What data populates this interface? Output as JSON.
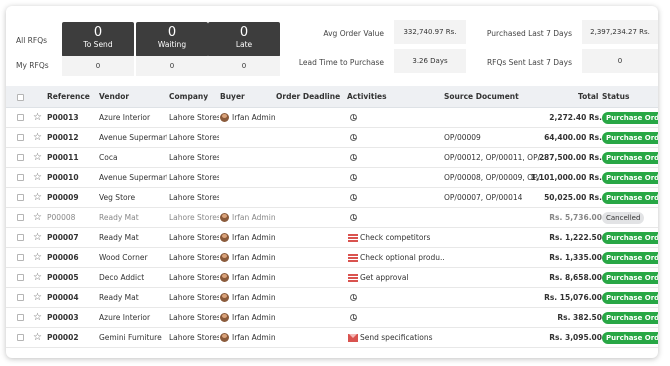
{
  "dashboard": {
    "all_rfqs_label": "All RFQs",
    "my_rfqs_label": "My RFQs",
    "boxes": [
      {
        "count": "0",
        "label": "To Send",
        "my": "0"
      },
      {
        "count": "0",
        "label": "Waiting",
        "my": "0"
      },
      {
        "count": "0",
        "label": "Late",
        "my": "0"
      }
    ],
    "stats": {
      "avg_order_value_label": "Avg Order Value",
      "avg_order_value": "332,740.97 Rs.",
      "purchased_7d_label": "Purchased Last 7 Days",
      "purchased_7d": "2,397,234.27 Rs.",
      "lead_time_label": "Lead Time to Purchase",
      "lead_time": "3.26 Days",
      "rfqs_sent_label": "RFQs Sent Last 7 Days",
      "rfqs_sent": "0"
    }
  },
  "table": {
    "headers": {
      "reference": "Reference",
      "vendor": "Vendor",
      "company": "Company",
      "buyer": "Buyer",
      "deadline": "Order Deadline",
      "activities": "Activities",
      "source": "Source Document",
      "total": "Total",
      "status": "Status"
    },
    "rows": [
      {
        "ref": "P00013",
        "vendor": "Azure Interior",
        "company": "Lahore Stores",
        "buyer": "Irfan Admin",
        "activity_icon": "clock-icon",
        "activity": "",
        "source": "",
        "total": "2,272.40 Rs.",
        "status": "Purchase Order"
      },
      {
        "ref": "P00012",
        "vendor": "Avenue Supermarts",
        "company": "Lahore Stores",
        "buyer": "",
        "activity_icon": "clock-icon",
        "activity": "",
        "source": "OP/00009",
        "total": "64,400.00 Rs.",
        "status": "Purchase Order"
      },
      {
        "ref": "P00011",
        "vendor": "Coca",
        "company": "Lahore Stores",
        "buyer": "",
        "activity_icon": "clock-icon",
        "activity": "",
        "source": "OP/00012, OP/00011, OP/...",
        "total": "287,500.00 Rs.",
        "status": "Purchase Order"
      },
      {
        "ref": "P00010",
        "vendor": "Avenue Supermarts",
        "company": "Lahore Stores",
        "buyer": "",
        "activity_icon": "clock-icon",
        "activity": "",
        "source": "OP/00008, OP/00009, OP/...",
        "total": "1,101,000.00 Rs.",
        "status": "Purchase Order"
      },
      {
        "ref": "P00009",
        "vendor": "Veg Store",
        "company": "Lahore Stores",
        "buyer": "",
        "activity_icon": "clock-icon",
        "activity": "",
        "source": "OP/00007, OP/00014",
        "total": "50,025.00 Rs.",
        "status": "Purchase Order"
      },
      {
        "ref": "P00008",
        "vendor": "Ready Mat",
        "company": "Lahore Stores",
        "buyer": "Irfan Admin",
        "activity_icon": "clock-icon",
        "activity": "",
        "source": "",
        "total": "Rs. 5,736.00",
        "status": "Cancelled",
        "muted": true
      },
      {
        "ref": "P00007",
        "vendor": "Ready Mat",
        "company": "Lahore Stores",
        "buyer": "Irfan Admin",
        "activity_icon": "todo-list-icon",
        "activity": "Check competitors",
        "source": "",
        "total": "Rs. 1,222.50",
        "status": "Purchase Order"
      },
      {
        "ref": "P00006",
        "vendor": "Wood Corner",
        "company": "Lahore Stores",
        "buyer": "Irfan Admin",
        "activity_icon": "todo-list-icon",
        "activity": "Check optional produ...",
        "source": "",
        "total": "Rs. 1,335.00",
        "status": "Purchase Order"
      },
      {
        "ref": "P00005",
        "vendor": "Deco Addict",
        "company": "Lahore Stores",
        "buyer": "Irfan Admin",
        "activity_icon": "todo-list-icon",
        "activity": "Get approval",
        "source": "",
        "total": "Rs. 8,658.00",
        "status": "Purchase Order"
      },
      {
        "ref": "P00004",
        "vendor": "Ready Mat",
        "company": "Lahore Stores",
        "buyer": "Irfan Admin",
        "activity_icon": "clock-icon",
        "activity": "",
        "source": "",
        "total": "Rs. 15,076.00",
        "status": "Purchase Order"
      },
      {
        "ref": "P00003",
        "vendor": "Azure Interior",
        "company": "Lahore Stores",
        "buyer": "Irfan Admin",
        "activity_icon": "clock-icon",
        "activity": "",
        "source": "",
        "total": "Rs. 382.50",
        "status": "Purchase Order"
      },
      {
        "ref": "P00002",
        "vendor": "Gemini Furniture",
        "company": "Lahore Stores",
        "buyer": "Irfan Admin",
        "activity_icon": "envelope-icon",
        "activity": "Send specifications",
        "source": "",
        "total": "Rs. 3,095.00",
        "status": "Purchase Order"
      }
    ]
  },
  "colors": {
    "status_ok": "#28a745",
    "dark_box": "#3d3d3d",
    "activity_red": "#d9534f"
  }
}
